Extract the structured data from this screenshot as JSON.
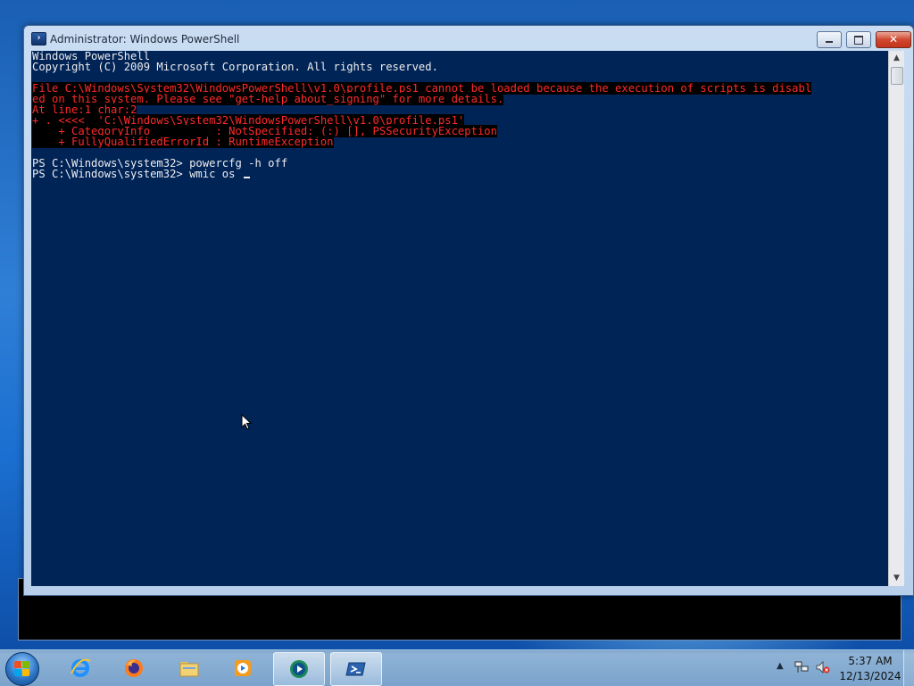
{
  "window": {
    "title": "Administrator: Windows PowerShell",
    "icon": "powershell-icon",
    "controls": {
      "minimize": "minimize-icon",
      "maximize": "maximize-icon",
      "close": "✕"
    }
  },
  "console": {
    "background": "#012456",
    "text_color": "#eeedf0",
    "error_color": "#ff2a2a",
    "lines": [
      {
        "text": "Windows PowerShell",
        "type": "normal"
      },
      {
        "text": "Copyright (C) 2009 Microsoft Corporation. All rights reserved.",
        "type": "normal"
      },
      {
        "text": "",
        "type": "normal"
      },
      {
        "text": "File C:\\Windows\\System32\\WindowsPowerShell\\v1.0\\profile.ps1 cannot be loaded because the execution of scripts is disabl",
        "type": "error"
      },
      {
        "text": "ed on this system. Please see \"get-help about_signing\" for more details.",
        "type": "error"
      },
      {
        "text": "At line:1 char:2",
        "type": "error"
      },
      {
        "text": "+ . <<<<  'C:\\Windows\\System32\\WindowsPowerShell\\v1.0\\profile.ps1'",
        "type": "error"
      },
      {
        "text": "    + CategoryInfo          : NotSpecified: (:) [], PSSecurityException",
        "type": "error"
      },
      {
        "text": "    + FullyQualifiedErrorId : RuntimeException",
        "type": "error"
      },
      {
        "text": "",
        "type": "normal"
      },
      {
        "text": "PS C:\\Windows\\system32> powercfg -h off",
        "type": "normal"
      },
      {
        "text": "PS C:\\Windows\\system32> wmic os ",
        "type": "prompt"
      }
    ]
  },
  "taskbar": {
    "start": "windows-start-icon",
    "items": [
      {
        "name": "internet-explorer",
        "icon": "ie-icon",
        "active": false
      },
      {
        "name": "firefox",
        "icon": "firefox-icon",
        "active": false
      },
      {
        "name": "file-explorer",
        "icon": "folder-icon",
        "active": false
      },
      {
        "name": "media-player",
        "icon": "media-player-icon",
        "active": false
      },
      {
        "name": "media-center",
        "icon": "media-center-icon",
        "active": true
      },
      {
        "name": "powershell",
        "icon": "powershell-icon",
        "active": true
      }
    ],
    "tray": {
      "time": "5:37 AM",
      "date": "12/13/2024",
      "icons": [
        "show-hidden-icons-arrow",
        "network-icon",
        "volume-muted-icon"
      ]
    }
  }
}
